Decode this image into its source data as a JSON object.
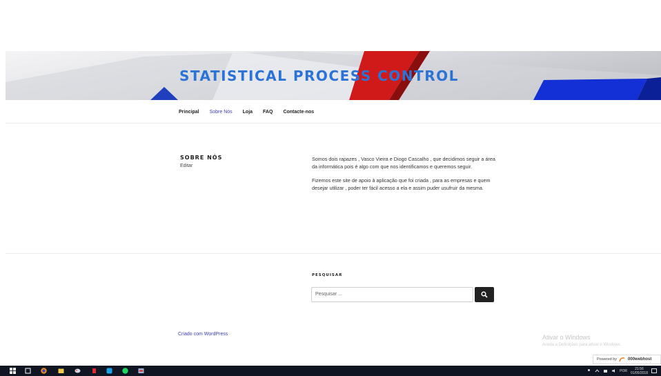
{
  "header": {
    "site_title": "STATISTICAL PROCESS CONTROL"
  },
  "nav": {
    "items": [
      {
        "label": "Principal",
        "current": false
      },
      {
        "label": "Sobre Nós",
        "current": true
      },
      {
        "label": "Loja",
        "current": false
      },
      {
        "label": "FAQ",
        "current": false
      },
      {
        "label": "Contacte-nos",
        "current": false
      }
    ]
  },
  "page": {
    "title": "SOBRE NÓS",
    "edit_label": "Editar",
    "paragraphs": [
      "Somos dois rapazes , Vasco Vieira e Diogo Cascalho , que decidimos seguir a área  da informática pois é algo com que nos identificamos e queremos seguir.",
      "Fizemos este site de apoio à aplicação que foi criada , para as empresas e quem desejar utilizar , poder ter fácil acesso a ela e assim puder usufruir da mesma."
    ]
  },
  "search": {
    "title": "PESQUISAR",
    "placeholder": "Pesquisar ..."
  },
  "footer": {
    "credit": "Criado com WordPress"
  },
  "windows_watermark": {
    "title": "Ativar o Windows",
    "subtitle": "Aceda a Definições para ativar o Windows."
  },
  "powered_badge": {
    "prefix": "Powered by",
    "brand": "000webhost"
  },
  "taskbar": {
    "language": "POR",
    "time": "21:56",
    "date": "01/05/2018",
    "icons": [
      "windows-start-icon",
      "task-view-icon",
      "firefox-icon",
      "file-explorer-icon",
      "paint-icon",
      "xampp-icon",
      "skype-icon",
      "spotify-icon",
      "app-icon"
    ]
  },
  "colors": {
    "accent": "#2b73d6",
    "link": "#3d3db3",
    "taskbar": "#0f1522"
  }
}
